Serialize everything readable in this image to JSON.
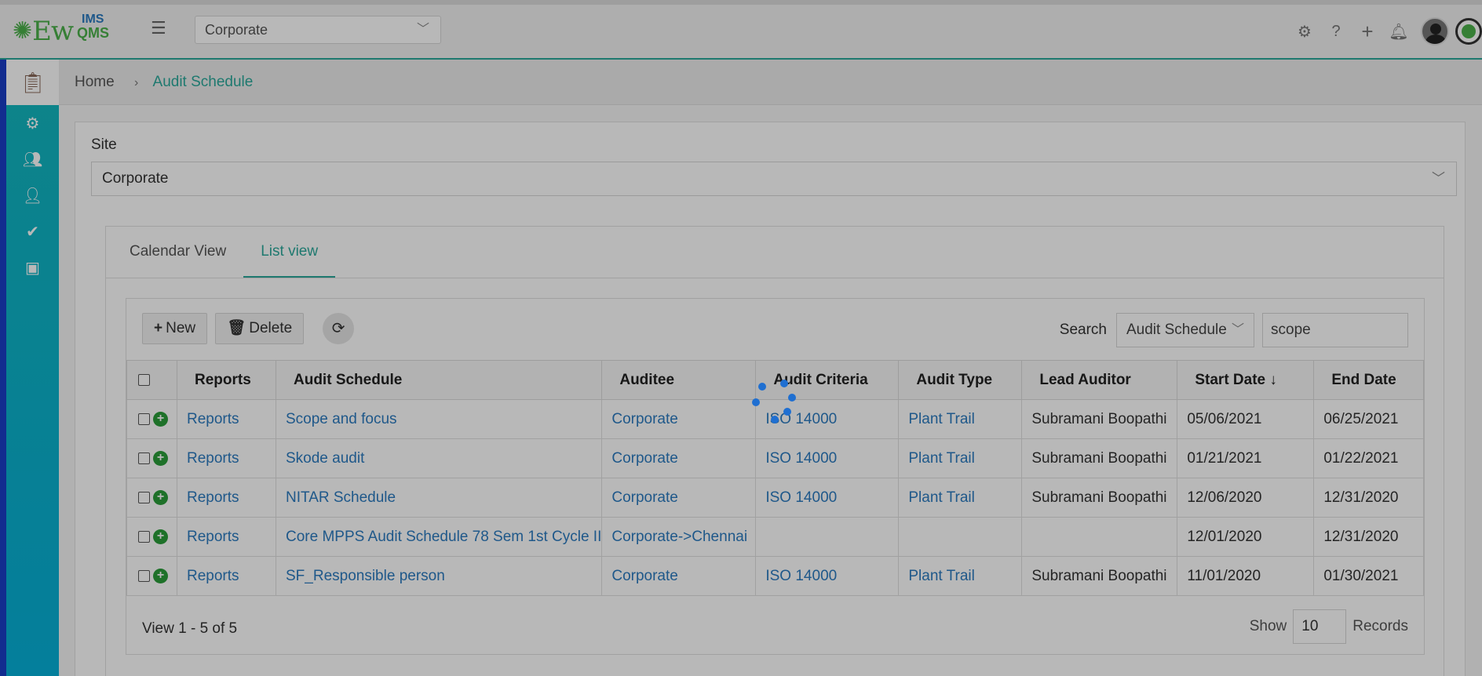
{
  "topbar": {
    "logo_prefix": "✺",
    "logo_main": "Ew",
    "logo_ims": "IMS",
    "logo_qms": "QMS",
    "site_value": "Corporate"
  },
  "breadcrumb": {
    "home": "Home",
    "current": "Audit Schedule"
  },
  "site": {
    "label": "Site",
    "value": "Corporate"
  },
  "tabs": [
    {
      "label": "Calendar View",
      "active": false
    },
    {
      "label": "List view",
      "active": true
    }
  ],
  "toolbar": {
    "new_label": "New",
    "delete_label": "Delete",
    "search_label": "Search",
    "search_field": "Audit Schedule",
    "search_value": "scope"
  },
  "table": {
    "columns": [
      "Reports",
      "Audit Schedule",
      "Auditee",
      "Audit Criteria",
      "Audit Type",
      "Lead Auditor",
      "Start Date",
      "End Date"
    ],
    "sort_indicator": "↓",
    "rows": [
      {
        "reports": "Reports",
        "schedule": "Scope and focus",
        "auditee": "Corporate",
        "criteria": "ISO 14000",
        "type": "Plant Trail",
        "lead": "Subramani Boopathi",
        "start": "05/06/2021",
        "end": "06/25/2021"
      },
      {
        "reports": "Reports",
        "schedule": "Skode audit",
        "auditee": "Corporate",
        "criteria": "ISO 14000",
        "type": "Plant Trail",
        "lead": "Subramani Boopathi",
        "start": "01/21/2021",
        "end": "01/22/2021"
      },
      {
        "reports": "Reports",
        "schedule": "NITAR Schedule",
        "auditee": "Corporate",
        "criteria": "ISO 14000",
        "type": "Plant Trail",
        "lead": "Subramani Boopathi",
        "start": "12/06/2020",
        "end": "12/31/2020"
      },
      {
        "reports": "Reports",
        "schedule": "Core MPPS Audit Schedule 78 Sem 1st Cycle II",
        "auditee": "Corporate->Chennai",
        "criteria": "",
        "type": "",
        "lead": "",
        "start": "12/01/2020",
        "end": "12/31/2020"
      },
      {
        "reports": "Reports",
        "schedule": "SF_Responsible person",
        "auditee": "Corporate",
        "criteria": "ISO 14000",
        "type": "Plant Trail",
        "lead": "Subramani Boopathi",
        "start": "11/01/2020",
        "end": "01/30/2021"
      }
    ]
  },
  "footer": {
    "view_text": "View 1 - 5 of 5",
    "show_label": "Show",
    "records_value": "10",
    "records_label": "Records"
  },
  "icons": {
    "top": [
      "gear-icon",
      "help-icon",
      "plus-icon",
      "bell-icon",
      "user-avatar",
      "brand-badge"
    ],
    "sidebar": [
      "audit-doc-icon",
      "gear-icon",
      "users-gear-icon",
      "user-shield-icon",
      "user-check-icon",
      "user-board-icon"
    ]
  },
  "colors": {
    "accent": "#2aa89a",
    "link": "#2b7bbf",
    "sidebar": "#13b7be",
    "spinner": "#1f6fd1"
  }
}
